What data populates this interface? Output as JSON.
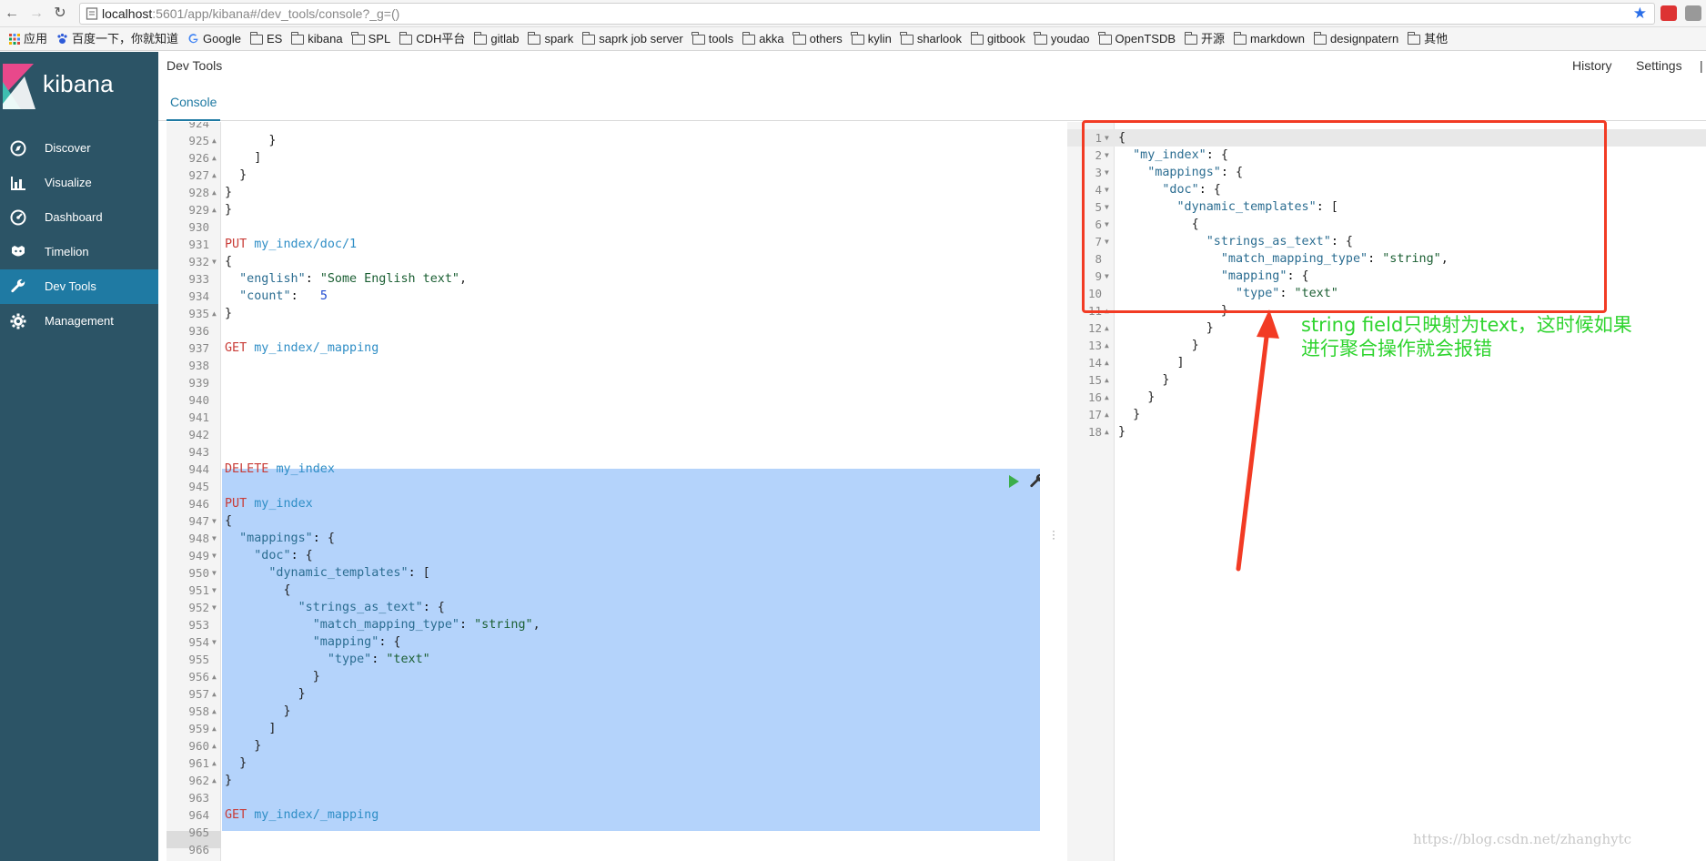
{
  "browser": {
    "url_host": "localhost",
    "url_rest": ":5601/app/kibana#/dev_tools/console?_g=()",
    "bookmarks": [
      "应用",
      "百度一下，你就知道",
      "Google",
      "ES",
      "kibana",
      "SPL",
      "CDH平台",
      "gitlab",
      "spark",
      "saprk job server",
      "tools",
      "akka",
      "others",
      "kylin",
      "sharlook",
      "gitbook",
      "youdao",
      "OpenTSDB",
      "开源",
      "markdown",
      "designpatern",
      "其他"
    ]
  },
  "sidebar": {
    "logo": "kibana",
    "items": [
      {
        "label": "Discover",
        "icon": "compass-icon"
      },
      {
        "label": "Visualize",
        "icon": "bar-chart-icon"
      },
      {
        "label": "Dashboard",
        "icon": "dashboard-icon"
      },
      {
        "label": "Timelion",
        "icon": "timelion-icon"
      },
      {
        "label": "Dev Tools",
        "icon": "wrench-icon"
      },
      {
        "label": "Management",
        "icon": "gear-icon"
      }
    ]
  },
  "header": {
    "title": "Dev Tools",
    "history": "History",
    "settings": "Settings",
    "tab": "Console"
  },
  "left_editor": {
    "lines": [
      [
        "924",
        ""
      ],
      [
        "925",
        "      }"
      ],
      [
        "926",
        "    ]"
      ],
      [
        "927",
        "  }"
      ],
      [
        "928",
        "}"
      ],
      [
        "929",
        "}"
      ],
      [
        "930",
        ""
      ],
      [
        "931",
        "PUT my_index/doc/1"
      ],
      [
        "932",
        "{"
      ],
      [
        "933",
        "  \"english\": \"Some English text\","
      ],
      [
        "934",
        "  \"count\":   5"
      ],
      [
        "935",
        "}"
      ],
      [
        "936",
        ""
      ],
      [
        "937",
        "GET my_index/_mapping"
      ],
      [
        "938",
        ""
      ],
      [
        "939",
        ""
      ],
      [
        "940",
        ""
      ],
      [
        "941",
        ""
      ],
      [
        "942",
        ""
      ],
      [
        "943",
        ""
      ],
      [
        "944",
        "DELETE my_index"
      ],
      [
        "945",
        ""
      ],
      [
        "946",
        "PUT my_index"
      ],
      [
        "947",
        "{"
      ],
      [
        "948",
        "  \"mappings\": {"
      ],
      [
        "949",
        "    \"doc\": {"
      ],
      [
        "950",
        "      \"dynamic_templates\": ["
      ],
      [
        "951",
        "        {"
      ],
      [
        "952",
        "          \"strings_as_text\": {"
      ],
      [
        "953",
        "            \"match_mapping_type\": \"string\","
      ],
      [
        "954",
        "            \"mapping\": {"
      ],
      [
        "955",
        "              \"type\": \"text\""
      ],
      [
        "956",
        "            }"
      ],
      [
        "957",
        "          }"
      ],
      [
        "958",
        "        }"
      ],
      [
        "959",
        "      ]"
      ],
      [
        "960",
        "    }"
      ],
      [
        "961",
        "  }"
      ],
      [
        "962",
        "}"
      ],
      [
        "963",
        ""
      ],
      [
        "964",
        "GET my_index/_mapping"
      ],
      [
        "965",
        ""
      ],
      [
        "966",
        ""
      ]
    ]
  },
  "right_editor": {
    "lines": [
      [
        "1",
        "{"
      ],
      [
        "2",
        "  \"my_index\": {"
      ],
      [
        "3",
        "    \"mappings\": {"
      ],
      [
        "4",
        "      \"doc\": {"
      ],
      [
        "5",
        "        \"dynamic_templates\": ["
      ],
      [
        "6",
        "          {"
      ],
      [
        "7",
        "            \"strings_as_text\": {"
      ],
      [
        "8",
        "              \"match_mapping_type\": \"string\","
      ],
      [
        "9",
        "              \"mapping\": {"
      ],
      [
        "10",
        "                \"type\": \"text\""
      ],
      [
        "11",
        "              }"
      ],
      [
        "12",
        "            }"
      ],
      [
        "13",
        "          }"
      ],
      [
        "14",
        "        ]"
      ],
      [
        "15",
        "      }"
      ],
      [
        "16",
        "    }"
      ],
      [
        "17",
        "  }"
      ],
      [
        "18",
        "}"
      ]
    ]
  },
  "annotation": {
    "line1": "string field只映射为text，这时候如果",
    "line2": "进行聚合操作就会报错",
    "color": "#2fd42f",
    "box_color": "#f23b24"
  },
  "watermark": "https://blog.csdn.net/zhanghytc"
}
